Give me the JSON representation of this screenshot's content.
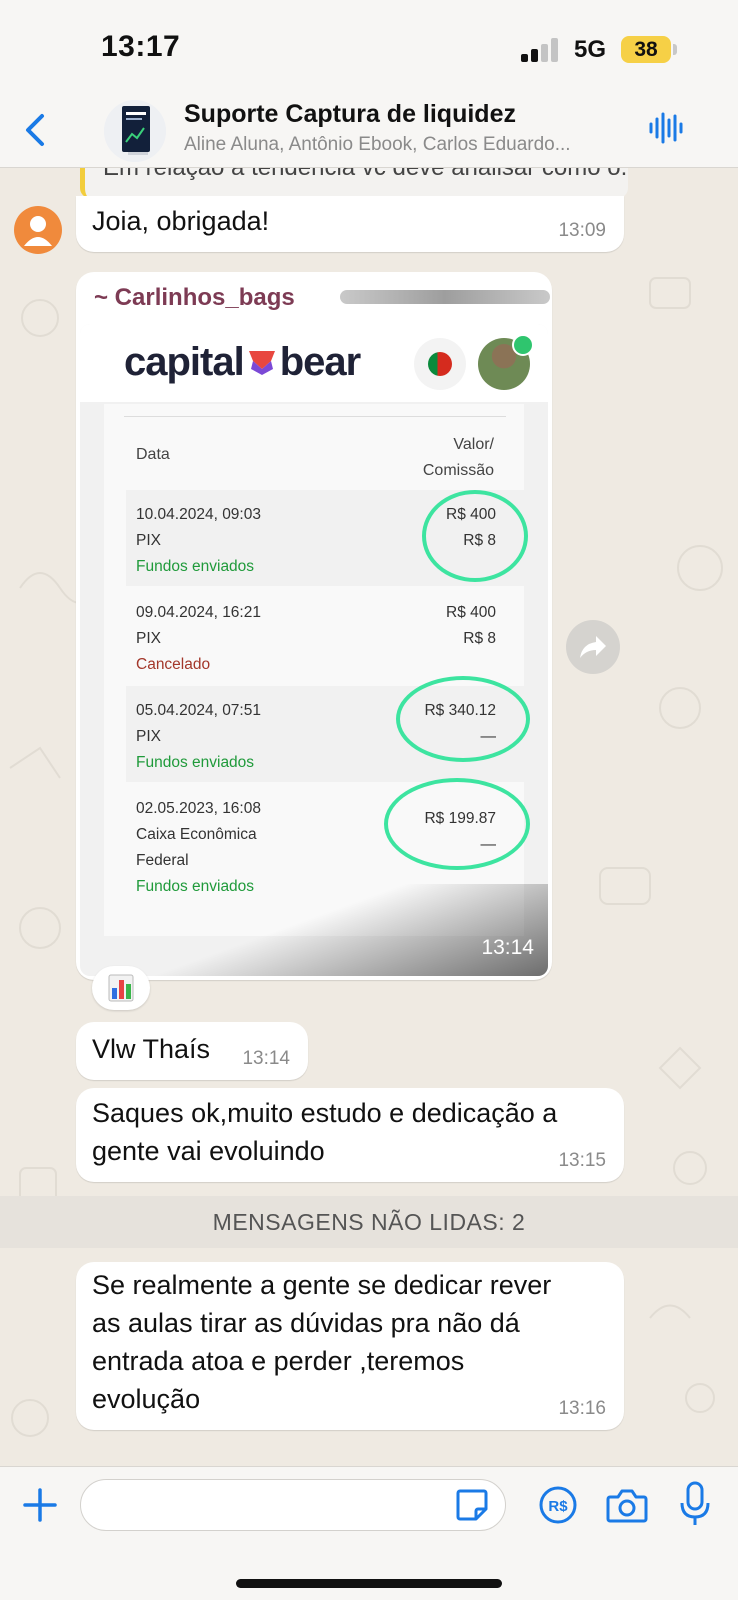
{
  "status_bar": {
    "time": "13:17",
    "network": "5G",
    "battery": "38"
  },
  "header": {
    "back_icon": "chevron-left-icon",
    "title": "Suporte Captura de liquidez",
    "members": "Aline Aluna, Antônio Ebook, Carlos Eduardo...",
    "voice_icon": "waveform-icon"
  },
  "messages": {
    "quote_text": "Em relação à tendência vc deve analisar como o...",
    "m1": {
      "text": "Joia, obrigada!",
      "time": "13:09"
    },
    "image_msg": {
      "sender": "~ Carlinhos_bags",
      "time": "13:14",
      "brand_left": "capital",
      "brand_right": "bear",
      "table": {
        "head_data": "Data",
        "head_valor": "Valor/",
        "head_comissao": "Comissão",
        "rows": [
          {
            "date": "10.04.2024, 09:03",
            "method": "PIX",
            "method2": "",
            "status": "Fundos enviados",
            "value": "R$ 400",
            "commission": "R$ 8"
          },
          {
            "date": "09.04.2024, 16:21",
            "method": "PIX",
            "method2": "",
            "status": "Cancelado",
            "value": "R$ 400",
            "commission": "R$ 8"
          },
          {
            "date": "05.04.2024, 07:51",
            "method": "PIX",
            "method2": "",
            "status": "Fundos enviados",
            "value": "R$ 340.12",
            "commission": "—"
          },
          {
            "date": "02.05.2023, 16:08",
            "method": "Caixa Econômica",
            "method2": "Federal",
            "status": "Fundos enviados",
            "value": "R$ 199.87",
            "commission": "—"
          }
        ]
      }
    },
    "reaction_icon": "bar-chart-emoji-icon",
    "m2": {
      "text": "Vlw Thaís",
      "time": "13:14"
    },
    "m3": {
      "line1": "Saques ok,muito estudo e dedicação a",
      "line2": "gente vai evoluindo",
      "time": "13:15"
    },
    "unread": "MENSAGENS NÃO LIDAS: 2",
    "m4": {
      "line1": "Se realmente a gente se dedicar rever",
      "line2": "as aulas tirar as dúvidas pra não dá",
      "line3": "entrada atoa e perder ,teremos",
      "line4": "evolução",
      "time": "13:16"
    }
  },
  "input_bar": {
    "placeholder": "",
    "icons": [
      "plus-icon",
      "sticker-icon",
      "pix-icon",
      "camera-icon",
      "microphone-icon"
    ]
  },
  "colors": {
    "accent": "#1a7ae6",
    "sender_name": "#7d3b54",
    "highlight_circle": "#3de4a0",
    "unread_bg": "#e6e2dc"
  }
}
